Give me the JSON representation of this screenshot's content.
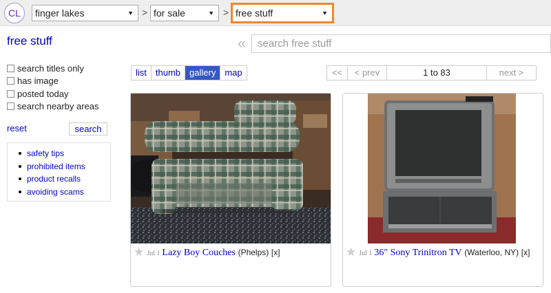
{
  "header": {
    "logo": "CL",
    "region": "finger lakes",
    "section": "for sale",
    "category": "free stuff",
    "separator": ">"
  },
  "page_title": "free stuff",
  "search": {
    "placeholder": "search free stuff",
    "chevron": "«"
  },
  "filters": [
    {
      "label": "search titles only",
      "checked": false
    },
    {
      "label": "has image",
      "checked": false
    },
    {
      "label": "posted today",
      "checked": false
    },
    {
      "label": "search nearby areas",
      "checked": false
    }
  ],
  "actions": {
    "reset": "reset",
    "search": "search"
  },
  "help_links": [
    "safety tips",
    "prohibited items",
    "product recalls",
    "avoiding scams"
  ],
  "view_tabs": [
    {
      "label": "list",
      "active": false
    },
    {
      "label": "thumb",
      "active": false
    },
    {
      "label": "gallery",
      "active": true
    },
    {
      "label": "map",
      "active": false
    }
  ],
  "pager": {
    "first": "<<",
    "prev": "< prev",
    "range": "1 to 83",
    "next": "next >"
  },
  "results": [
    {
      "star": "★",
      "date": "Jul 1",
      "title": "Lazy Boy Couches",
      "location": "(Phelps)",
      "hide": "[x]"
    },
    {
      "star": "★",
      "date": "Jul 1",
      "title": "36\" Sony Trinitron TV",
      "location": "(Waterloo, NY)",
      "hide": "[x]"
    }
  ],
  "colors": {
    "accent": "#f0862b",
    "link": "#0000cc",
    "active_tab": "#3557c6"
  }
}
